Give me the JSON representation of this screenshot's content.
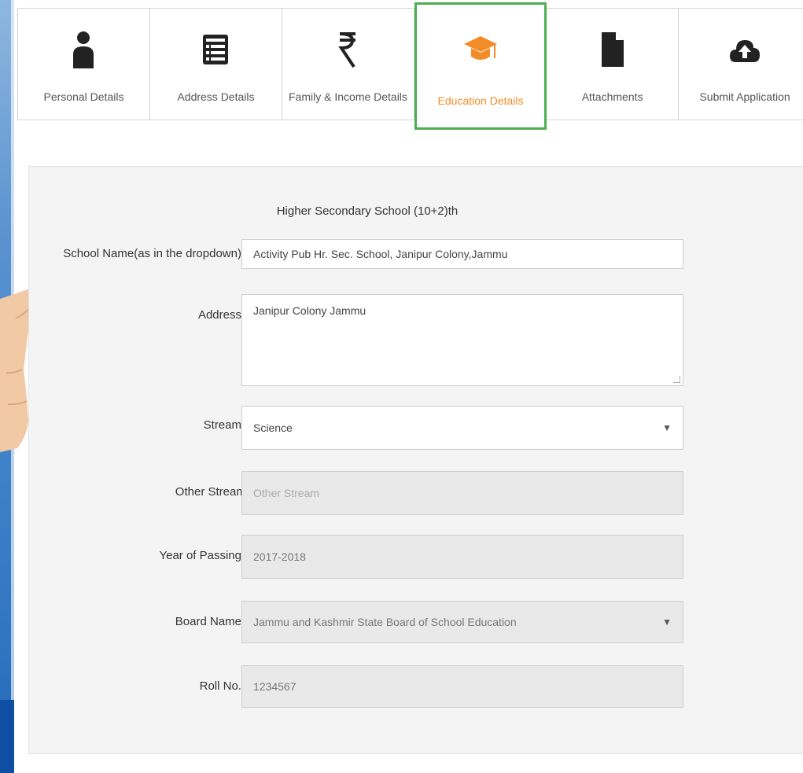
{
  "tabs": [
    {
      "label": "Personal Details",
      "icon": "person-icon"
    },
    {
      "label": "Address Details",
      "icon": "list-icon"
    },
    {
      "label": "Family & Income Details",
      "icon": "rupee-icon"
    },
    {
      "label": "Education Details",
      "icon": "graduation-cap-icon",
      "active": true
    },
    {
      "label": "Attachments",
      "icon": "file-icon"
    },
    {
      "label": "Submit Application",
      "icon": "upload-icon"
    }
  ],
  "form": {
    "section_title": "Higher Secondary School (10+2)th",
    "school_name_label": "School Name(as in the dropdown):",
    "school_name_value": "Activity Pub Hr. Sec. School, Janipur Colony,Jammu",
    "address_label": "Address:",
    "address_value": "Janipur Colony Jammu",
    "stream_label": "Stream:",
    "stream_value": "Science",
    "other_stream_label": "Other Stream:",
    "other_stream_placeholder": "Other Stream",
    "year_label": "Year of Passing:",
    "year_value": "2017-2018",
    "board_label": "Board Name:",
    "board_value": "Jammu and Kashmir State Board of School Education",
    "roll_label": "Roll No.:",
    "roll_value": "1234567",
    "required_mark": "*"
  },
  "colors": {
    "active_border": "#4caf50",
    "active_label": "#f28c28",
    "required": "#c0392b"
  }
}
